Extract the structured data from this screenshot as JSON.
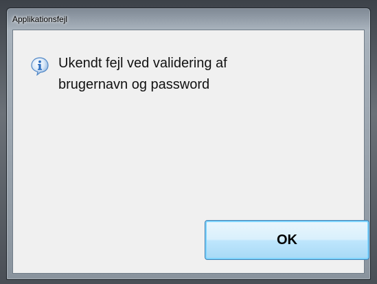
{
  "dialog": {
    "title": "Applikationsfejl",
    "icon": "info-icon",
    "message_line1": "Ukendt fejl ved validering af",
    "message_line2": "brugernavn og password",
    "ok_label": "OK"
  },
  "colors": {
    "client_background": "#f0f0f0",
    "button_border": "#3c7fb1",
    "icon_blue": "#2f6fc0"
  }
}
